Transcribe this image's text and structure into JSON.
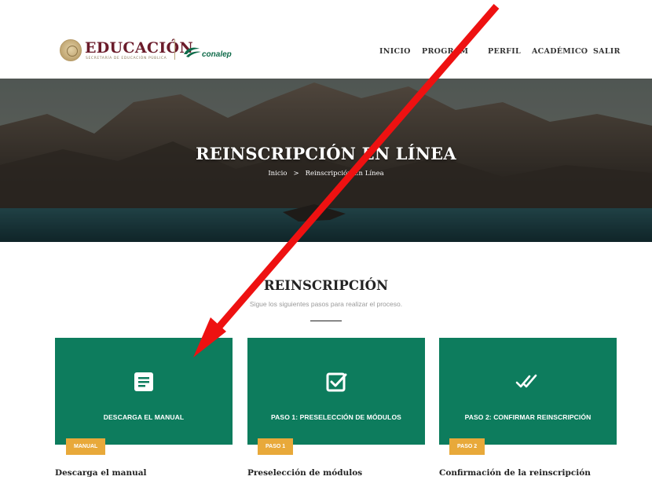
{
  "header": {
    "logo_text": "EDUCACIÓN",
    "logo_subtext": "SECRETARÍA DE EDUCACIÓN PÚBLICA",
    "partner_logo_text": "conalep",
    "nav": {
      "inicio": "INICIO",
      "programas": "PROGRAM",
      "perfil": "PERFIL",
      "academico": "ACADÉMICO",
      "academico_caret": "▾",
      "salir": "SALIR"
    }
  },
  "hero": {
    "title": "REINSCRIPCIÓN EN LÍNEA",
    "breadcrumb": {
      "home": "Inicio",
      "separator": ">",
      "current": "Reinscripción En Línea"
    }
  },
  "section": {
    "title": "REINSCRIPCIÓN",
    "subtitle": "Sigue los siguientes pasos para realizar el proceso."
  },
  "cards": [
    {
      "icon": "document-icon",
      "label": "DESCARGA EL MANUAL",
      "badge": "MANUAL",
      "title": "Descarga el manual"
    },
    {
      "icon": "checkbox-icon",
      "label": "PASO 1: PRESELECCIÓN DE MÓDULOS",
      "badge": "PASO 1",
      "title": "Preselección de módulos"
    },
    {
      "icon": "double-check-icon",
      "label": "PASO 2: CONFIRMAR REINSCRIPCIÓN",
      "badge": "PASO 2",
      "title": "Confirmación de la reinscripción"
    }
  ],
  "colors": {
    "card_green": "#0d7c5d",
    "badge_gold": "#e8a93a",
    "logo_maroon": "#6b1c2b",
    "annotation_red": "#ee1111"
  }
}
